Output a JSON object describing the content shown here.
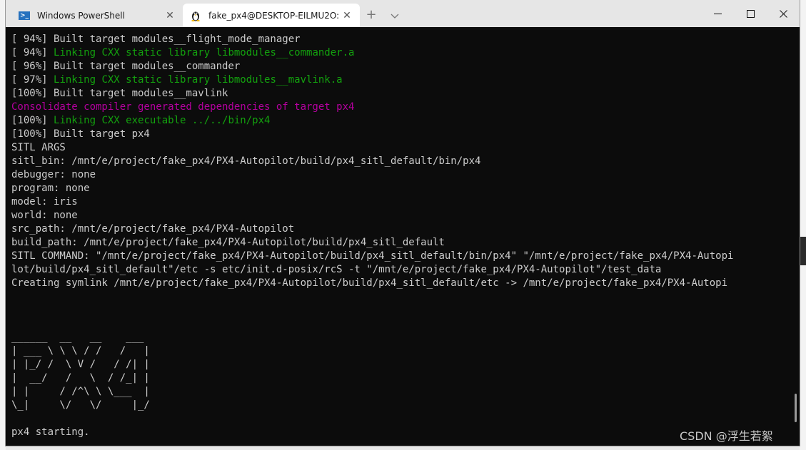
{
  "tabs": [
    {
      "label": "Windows PowerShell",
      "icon": "powershell-icon"
    },
    {
      "label": "fake_px4@DESKTOP-EILMU2O:",
      "icon": "linux-penguin-icon"
    }
  ],
  "colors": {
    "green": "#13a10e",
    "magenta": "#b4009e",
    "text": "#cccccc",
    "background": "#0c0c0c"
  },
  "terminal": {
    "lines": [
      {
        "text": "[ 94%] Built target modules__flight_mode_manager",
        "color": "default"
      },
      {
        "prefix": "[ 94%] ",
        "text": "Linking CXX static library libmodules__commander.a",
        "color": "green"
      },
      {
        "text": "[ 96%] Built target modules__commander",
        "color": "default"
      },
      {
        "prefix": "[ 97%] ",
        "text": "Linking CXX static library libmodules__mavlink.a",
        "color": "green"
      },
      {
        "text": "[100%] Built target modules__mavlink",
        "color": "default"
      },
      {
        "text": "Consolidate compiler generated dependencies of target px4",
        "color": "magenta"
      },
      {
        "prefix": "[100%] ",
        "text": "Linking CXX executable ../../bin/px4",
        "color": "green"
      },
      {
        "text": "[100%] Built target px4",
        "color": "default"
      },
      {
        "text": "SITL ARGS",
        "color": "default"
      },
      {
        "text": "sitl_bin: /mnt/e/project/fake_px4/PX4-Autopilot/build/px4_sitl_default/bin/px4",
        "color": "default"
      },
      {
        "text": "debugger: none",
        "color": "default"
      },
      {
        "text": "program: none",
        "color": "default"
      },
      {
        "text": "model: iris",
        "color": "default"
      },
      {
        "text": "world: none",
        "color": "default"
      },
      {
        "text": "src_path: /mnt/e/project/fake_px4/PX4-Autopilot",
        "color": "default"
      },
      {
        "text": "build_path: /mnt/e/project/fake_px4/PX4-Autopilot/build/px4_sitl_default",
        "color": "default"
      },
      {
        "text": "SITL COMMAND: \"/mnt/e/project/fake_px4/PX4-Autopilot/build/px4_sitl_default/bin/px4\" \"/mnt/e/project/fake_px4/PX4-Autopi",
        "color": "default"
      },
      {
        "text": "lot/build/px4_sitl_default\"/etc -s etc/init.d-posix/rcS -t \"/mnt/e/project/fake_px4/PX4-Autopilot\"/test_data",
        "color": "default"
      },
      {
        "text": "Creating symlink /mnt/e/project/fake_px4/PX4-Autopilot/build/px4_sitl_default/etc -> /mnt/e/project/fake_px4/PX4-Autopi",
        "color": "default"
      },
      {
        "text": "",
        "color": "default"
      },
      {
        "text": "",
        "color": "default"
      },
      {
        "text": "",
        "color": "default"
      },
      {
        "text": "______  __   __    ___ ",
        "color": "default"
      },
      {
        "text": "| ___ \\ \\ \\ / /   /   |",
        "color": "default"
      },
      {
        "text": "| |_/ /  \\ V /   / /| |",
        "color": "default"
      },
      {
        "text": "|  __/   /   \\  / /_| |",
        "color": "default"
      },
      {
        "text": "| |     / /^\\ \\ \\___  |",
        "color": "default"
      },
      {
        "text": "\\_|     \\/   \\/     |_/",
        "color": "default"
      },
      {
        "text": "",
        "color": "default"
      },
      {
        "text": "px4 starting.",
        "color": "default"
      }
    ]
  },
  "watermark": "CSDN @浮生若絮"
}
